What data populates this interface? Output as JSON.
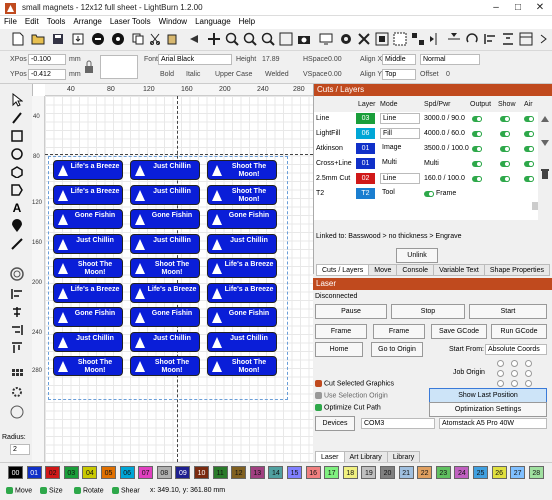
{
  "window": {
    "title": "small magnets - 12x12 full sheet - LightBurn 1.2.00"
  },
  "menu": [
    "File",
    "Edit",
    "Tools",
    "Arrange",
    "Laser Tools",
    "Window",
    "Language",
    "Help"
  ],
  "toolbar2": {
    "xpos_label": "XPos",
    "xpos": "-0.100",
    "ypos_label": "YPos",
    "ypos": "-0.412",
    "unit": "mm",
    "font_label": "Font",
    "font": "Arial Black",
    "height_label": "Height",
    "height": "17.89",
    "hspace_label": "HSpace",
    "hspace": "0.00",
    "alignx_label": "Align X",
    "alignx": "Middle",
    "style": "Normal",
    "bold": "Bold",
    "italic": "Italic",
    "upper": "Upper Case",
    "welded": "Welded",
    "vspace_label": "VSpace",
    "vspace": "0.00",
    "aligny_label": "Align Y",
    "aligny": "Top",
    "offset_label": "Offset",
    "offset": "0"
  },
  "ruler": {
    "top": [
      "40",
      "80",
      "120",
      "160",
      "200",
      "240",
      "280"
    ],
    "left": [
      "40",
      "80",
      "120",
      "160",
      "200",
      "240",
      "280"
    ]
  },
  "tags": [
    [
      "Life's a Breeze",
      "Just Chillin",
      "Shoot The Moon!"
    ],
    [
      "Life's a Breeze",
      "Just Chillin",
      "Shoot The Moon!"
    ],
    [
      "Gone Fishin",
      "Gone Fishin",
      "Gone Fishin"
    ],
    [
      "Just Chillin",
      "Just Chillin",
      "Just Chillin"
    ],
    [
      "Shoot The Moon!",
      "Shoot The Moon!",
      "Life's a Breeze"
    ],
    [
      "Life's a Breeze",
      "Life's a Breeze",
      "Life's a Breeze"
    ],
    [
      "Gone Fishin",
      "Gone Fishin",
      "Gone Fishin"
    ],
    [
      "Just Chillin",
      "Just Chillin",
      "Just Chillin"
    ],
    [
      "Shoot The Moon!",
      "Shoot The Moon!",
      "Shoot The Moon!"
    ]
  ],
  "radius": {
    "label": "Radius:",
    "value": "2"
  },
  "cuts": {
    "title": "Cuts / Layers",
    "headers": [
      "#",
      "Layer",
      "Mode",
      "Spd/Pwr",
      "Output",
      "Show",
      "Air"
    ],
    "rows": [
      {
        "name": "Line",
        "layer": "03",
        "color": "#1a9e3a",
        "mode": "Line",
        "spd": "3000.0 / 90.0"
      },
      {
        "name": "LightFill",
        "layer": "06",
        "color": "#00a6d6",
        "mode": "Fill",
        "spd": "4000.0 / 60.0"
      },
      {
        "name": "Atkinson",
        "layer": "01",
        "color": "#1030c8",
        "mode": "Image",
        "spd": "3500.0 / 100.0"
      },
      {
        "name": "Cross+Line",
        "layer": "01",
        "color": "#1030c8",
        "mode": "Multi",
        "spd": "Multi"
      },
      {
        "name": "2.5mm Cut",
        "layer": "02",
        "color": "#d01818",
        "mode": "Line",
        "spd": "160.0 / 100.0"
      },
      {
        "name": "T2",
        "layer": "T2",
        "color": "#1a7ed0",
        "mode": "Tool",
        "spd": "Frame"
      }
    ],
    "linked": "Linked to: Basswood > no thickness > Engrave",
    "unlink": "Unlink",
    "tabs": [
      "Cuts / Layers",
      "Move",
      "Console",
      "Variable Text",
      "Shape Properties"
    ]
  },
  "laser": {
    "title": "Laser",
    "status": "Disconnected",
    "pause": "Pause",
    "stop": "Stop",
    "start": "Start",
    "frame1": "Frame",
    "frame2": "Frame",
    "save": "Save GCode",
    "run": "Run GCode",
    "home": "Home",
    "origin": "Go to Origin",
    "startfrom_label": "Start From:",
    "startfrom": "Absolute Coords",
    "joborigin": "Job Origin",
    "cut_selected": "Cut Selected Graphics",
    "use_origin": "Use Selection Origin",
    "optimize": "Optimize Cut Path",
    "show_last": "Show Last Position",
    "opt_settings": "Optimization Settings",
    "devices": "Devices",
    "port": "COM3",
    "device": "Atomstack A5 Pro 40W",
    "tabs": [
      "Laser",
      "Art Library",
      "Library"
    ]
  },
  "palette": {
    "labels": [
      "00",
      "01",
      "02",
      "03",
      "04",
      "05",
      "06",
      "07",
      "08",
      "09",
      "10",
      "11",
      "12",
      "13",
      "14",
      "15",
      "16",
      "17",
      "18",
      "19",
      "20",
      "21",
      "22",
      "23",
      "24",
      "25",
      "26",
      "27",
      "28"
    ],
    "colors": [
      "#000000",
      "#1030c8",
      "#d01818",
      "#1a9e3a",
      "#c8c800",
      "#e07000",
      "#00a6d6",
      "#e040c0",
      "#b0b0b0",
      "#1e2090",
      "#7a2a10",
      "#2a7a2a",
      "#806020",
      "#a04080",
      "#50a0a0",
      "#8080ff",
      "#f08080",
      "#80f080",
      "#f0f080",
      "#c0c0c0",
      "#808080",
      "#a0c0e0",
      "#e0a060",
      "#60c060",
      "#c060c0",
      "#40a0e0",
      "#e0e040",
      "#80c0ff",
      "#a0e0a0"
    ]
  },
  "status": {
    "move": "Move",
    "size": "Size",
    "rotate": "Rotate",
    "shear": "Shear",
    "coords": "x: 349.10, y: 361.80 mm"
  }
}
